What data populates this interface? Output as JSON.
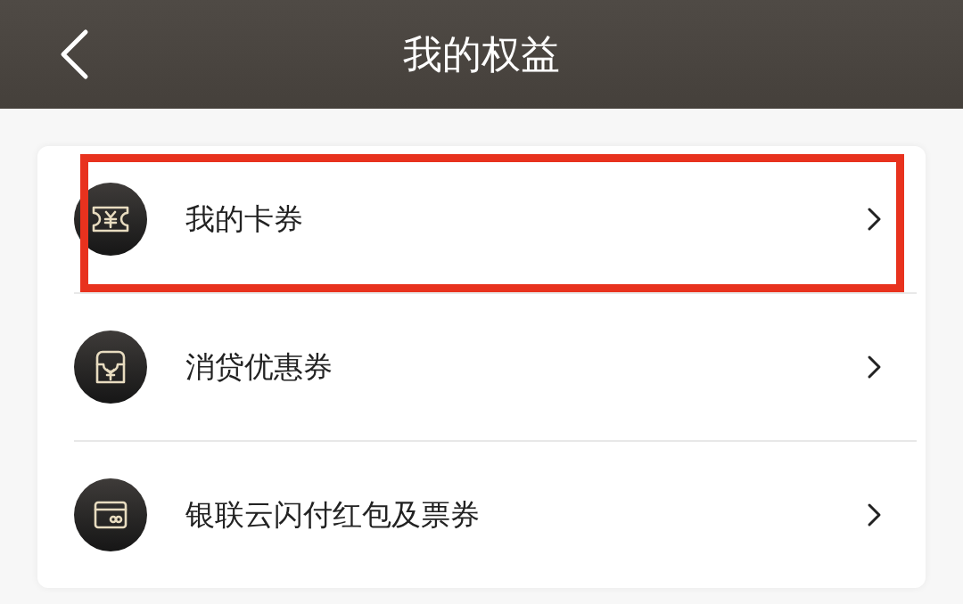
{
  "header": {
    "title": "我的权益"
  },
  "items": [
    {
      "label": "我的卡券",
      "highlighted": true
    },
    {
      "label": "消贷优惠券",
      "highlighted": false
    },
    {
      "label": "银联云闪付红包及票券",
      "highlighted": false
    }
  ]
}
